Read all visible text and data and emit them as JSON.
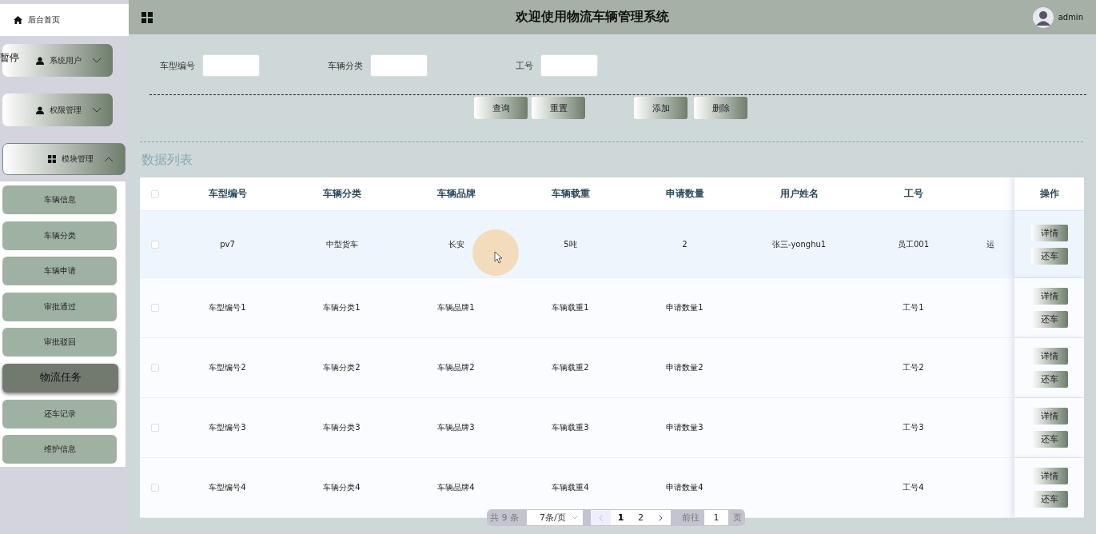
{
  "sidebar": {
    "home": {
      "label": "后台首页"
    },
    "overlay_text": "暂停",
    "menus": [
      {
        "label": "系统用户",
        "kind": "person",
        "expanded": false
      },
      {
        "label": "权限管理",
        "kind": "person",
        "expanded": false
      },
      {
        "label": "模块管理",
        "kind": "grid",
        "expanded": true,
        "children": [
          {
            "label": "车辆信息",
            "selected": false
          },
          {
            "label": "车辆分类",
            "selected": false
          },
          {
            "label": "车辆申请",
            "selected": false
          },
          {
            "label": "审批通过",
            "selected": false
          },
          {
            "label": "审批驳回",
            "selected": false
          },
          {
            "label": "物流任务",
            "selected": true
          },
          {
            "label": "还车记录",
            "selected": false
          },
          {
            "label": "维护信息",
            "selected": false
          }
        ]
      }
    ]
  },
  "header": {
    "title": "欢迎使用物流车辆管理系统",
    "user": "admin"
  },
  "search": {
    "fields": [
      {
        "label": "车型编号"
      },
      {
        "label": "车辆分类"
      },
      {
        "label": "工号"
      }
    ],
    "buttons": [
      "查询",
      "重置",
      "添加",
      "删除"
    ]
  },
  "table": {
    "title": "数据列表",
    "header_checked": false,
    "columns": [
      "车型编号",
      "车辆分类",
      "车辆品牌",
      "车辆载重",
      "申请数量",
      "用户姓名",
      "工号",
      "操作"
    ],
    "rows": [
      {
        "selected": true,
        "checked": false,
        "cells": [
          "pv7",
          "中型货车",
          "长安",
          "5吨",
          "2",
          "张三-yonghu1",
          "员工001",
          "运"
        ],
        "actions": [
          "详情",
          "还车"
        ]
      },
      {
        "selected": false,
        "checked": false,
        "cells": [
          "车型编号1",
          "车辆分类1",
          "车辆品牌1",
          "车辆载重1",
          "申请数量1",
          "",
          "工号1",
          ""
        ],
        "actions": [
          "详情",
          "还车"
        ]
      },
      {
        "selected": false,
        "checked": false,
        "cells": [
          "车型编号2",
          "车辆分类2",
          "车辆品牌2",
          "车辆载重2",
          "申请数量2",
          "",
          "工号2",
          ""
        ],
        "actions": [
          "详情",
          "还车"
        ]
      },
      {
        "selected": false,
        "checked": false,
        "cells": [
          "车型编号3",
          "车辆分类3",
          "车辆品牌3",
          "车辆载重3",
          "申请数量3",
          "",
          "工号3",
          ""
        ],
        "actions": [
          "详情",
          "还车"
        ]
      },
      {
        "selected": false,
        "checked": false,
        "cells": [
          "车型编号4",
          "车辆分类4",
          "车辆品牌4",
          "车辆载重4",
          "申请数量4",
          "",
          "工号4",
          ""
        ],
        "actions": [
          "详情",
          "还车"
        ]
      }
    ]
  },
  "pagination": {
    "total": "共 9 条",
    "page_size": "7条/页",
    "pages": [
      {
        "label": "1",
        "selected": true
      },
      {
        "label": "2",
        "selected": false
      }
    ],
    "goto_label": "前往",
    "goto_value": "1",
    "page_suffix": "页"
  }
}
